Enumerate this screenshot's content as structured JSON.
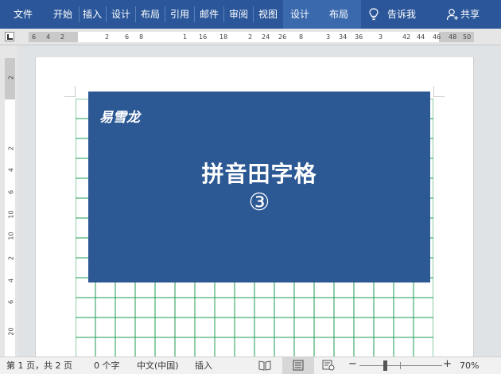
{
  "ribbon": {
    "tabs": [
      {
        "label": "文件"
      },
      {
        "label": "开始"
      },
      {
        "label": "插入"
      },
      {
        "label": "设计"
      },
      {
        "label": "布局"
      },
      {
        "label": "引用"
      },
      {
        "label": "邮件"
      },
      {
        "label": "审阅"
      },
      {
        "label": "视图"
      },
      {
        "label": "设计"
      },
      {
        "label": "布局"
      }
    ],
    "tell_me": "告诉我",
    "share": "共享",
    "bg_color": "#2b579a"
  },
  "hruler": {
    "numbers": [
      "6",
      "4",
      "2",
      "2",
      "4",
      "6",
      "8",
      "1",
      "16",
      "18",
      "2",
      "24",
      "26",
      "8",
      "3",
      "34",
      "36",
      "3",
      "42",
      "44",
      "46",
      "48",
      "50"
    ]
  },
  "vruler": {
    "numbers": [
      "2",
      "2",
      "4",
      "6",
      "8",
      "10",
      "2",
      "4",
      "6",
      "20"
    ]
  },
  "document": {
    "logo": "易雪龙",
    "headline": "拼音田字格",
    "circled_number": "③",
    "banner_color": "#2c5894",
    "grid_color": "#1e9b52"
  },
  "status": {
    "page": "第 1 页，共 2 页",
    "words": "0 个字",
    "language": "中文(中国)",
    "mode": "插入",
    "zoom_minus": "−",
    "zoom_plus": "+",
    "zoom": "70%"
  }
}
